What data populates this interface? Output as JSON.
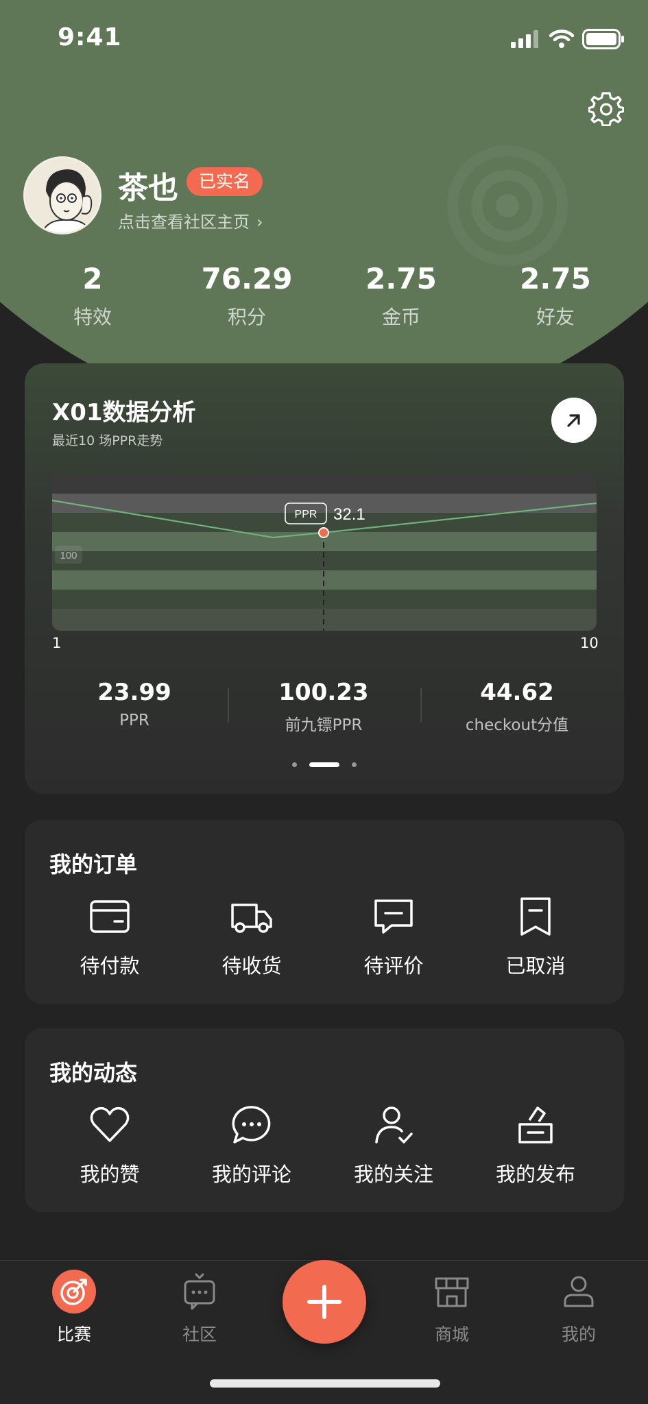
{
  "status_bar": {
    "time": "9:41"
  },
  "profile": {
    "name": "茶也",
    "verified_badge": "已实名",
    "community_link": "点击查看社区主页",
    "link_chevron": "›"
  },
  "stats": [
    {
      "value": "2",
      "label": "特效"
    },
    {
      "value": "76.29",
      "label": "积分"
    },
    {
      "value": "2.75",
      "label": "金币"
    },
    {
      "value": "2.75",
      "label": "好友"
    }
  ],
  "analysis": {
    "title": "X01数据分析",
    "subtitle": "最近10 场PPR走势",
    "tooltip_label": "PPR",
    "tooltip_value": "32.1",
    "y_tick": "100",
    "x_start": "1",
    "x_end": "10",
    "metrics": [
      {
        "value": "23.99",
        "label": "PPR"
      },
      {
        "value": "100.23",
        "label": "前九镖PPR"
      },
      {
        "value": "44.62",
        "label": "checkout分值"
      }
    ],
    "page_dots": 3,
    "active_dot": 1
  },
  "chart_data": {
    "type": "line",
    "x": [
      1,
      10
    ],
    "series": [],
    "highlight": {
      "label": "PPR",
      "value": 32.1
    },
    "ytick_labels": [
      "100"
    ],
    "xtick_labels": [
      "1",
      "10"
    ]
  },
  "orders": {
    "title": "我的订单",
    "items": [
      {
        "label": "待付款",
        "icon": "wallet-icon"
      },
      {
        "label": "待收货",
        "icon": "truck-icon"
      },
      {
        "label": "待评价",
        "icon": "message-icon"
      },
      {
        "label": "已取消",
        "icon": "cancel-icon"
      }
    ]
  },
  "activity": {
    "title": "我的动态",
    "items": [
      {
        "label": "我的赞",
        "icon": "heart-icon"
      },
      {
        "label": "我的评论",
        "icon": "comment-icon"
      },
      {
        "label": "我的关注",
        "icon": "follow-icon"
      },
      {
        "label": "我的发布",
        "icon": "publish-icon"
      }
    ]
  },
  "tabbar": {
    "items": [
      {
        "label": "比赛",
        "icon": "match-icon",
        "active": true
      },
      {
        "label": "社区",
        "icon": "community-icon",
        "active": false
      },
      {
        "label": "商城",
        "icon": "shop-icon",
        "active": false
      },
      {
        "label": "我的",
        "icon": "profile-icon",
        "active": false
      }
    ],
    "fab_icon": "plus-icon"
  },
  "colors": {
    "hero_green": "#5f7757",
    "accent": "#f26a4f",
    "background": "#232323",
    "card": "#2b2b2b"
  }
}
